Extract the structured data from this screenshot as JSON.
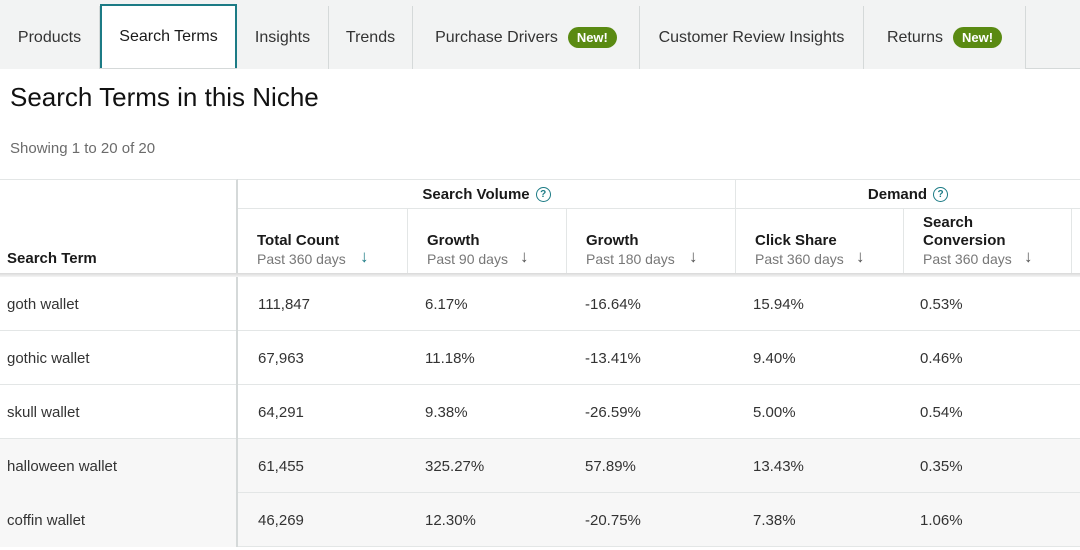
{
  "tabs": [
    {
      "label": "Products",
      "badge": "",
      "active": false
    },
    {
      "label": "Search Terms",
      "badge": "",
      "active": true
    },
    {
      "label": "Insights",
      "badge": "",
      "active": false
    },
    {
      "label": "Trends",
      "badge": "",
      "active": false
    },
    {
      "label": "Purchase Drivers",
      "badge": "New!",
      "active": false
    },
    {
      "label": "Customer Review Insights",
      "badge": "",
      "active": false
    },
    {
      "label": "Returns",
      "badge": "New!",
      "active": false
    }
  ],
  "title": "Search Terms in this Niche",
  "showing": "Showing 1 to 20 of 20",
  "colors": {
    "accent": "#1c7b85",
    "badge": "#5a8a12"
  },
  "table": {
    "row_header": "Search Term",
    "groups": [
      {
        "label": "Search Volume",
        "icon": "help-circle-icon"
      },
      {
        "label": "Demand",
        "icon": "help-circle-icon"
      }
    ],
    "columns": [
      {
        "title": "Total Count",
        "sub": "Past 360 days",
        "sorted": true
      },
      {
        "title": "Growth",
        "sub": "Past 90 days",
        "sorted": false
      },
      {
        "title": "Growth",
        "sub": "Past 180 days",
        "sorted": false
      },
      {
        "title": "Click Share",
        "sub": "Past 360 days",
        "sorted": false
      },
      {
        "title_line1": "Search",
        "title_line2": "Conversion",
        "sub": "Past 360 days",
        "sorted": false
      }
    ],
    "rows": [
      {
        "term": "goth wallet",
        "values": [
          "111,847",
          "6.17%",
          "-16.64%",
          "15.94%",
          "0.53%"
        ]
      },
      {
        "term": "gothic wallet",
        "values": [
          "67,963",
          "11.18%",
          "-13.41%",
          "9.40%",
          "0.46%"
        ]
      },
      {
        "term": "skull wallet",
        "values": [
          "64,291",
          "9.38%",
          "-26.59%",
          "5.00%",
          "0.54%"
        ]
      },
      {
        "term": "halloween wallet",
        "values": [
          "61,455",
          "325.27%",
          "57.89%",
          "13.43%",
          "0.35%"
        ]
      },
      {
        "term": "coffin wallet",
        "values": [
          "46,269",
          "12.30%",
          "-20.75%",
          "7.38%",
          "1.06%"
        ]
      }
    ]
  }
}
